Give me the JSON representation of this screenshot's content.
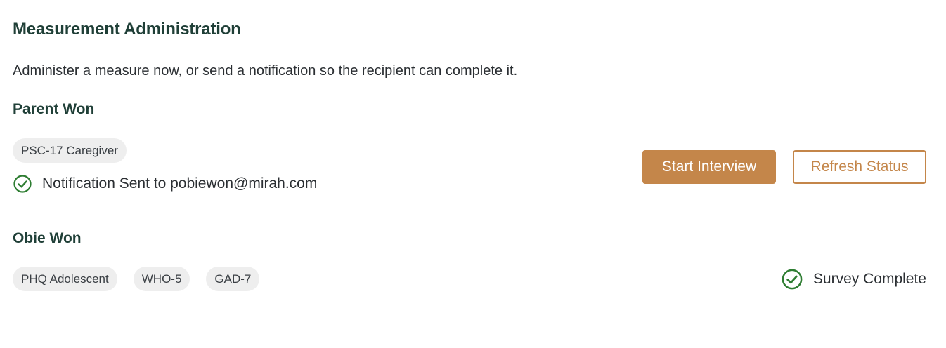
{
  "page": {
    "title": "Measurement Administration",
    "subtitle": "Administer a measure now, or send a notification so the recipient can complete it."
  },
  "recipients": [
    {
      "name": "Parent Won",
      "measures": [
        "PSC-17 Caregiver"
      ],
      "status_text": "Notification Sent to pobiewon@mirah.com",
      "start_button": "Start Interview",
      "refresh_button": "Refresh Status"
    },
    {
      "name": "Obie Won",
      "measures": [
        "PHQ Adolescent",
        "WHO-5",
        "GAD-7"
      ],
      "status_text": "Survey Complete"
    }
  ],
  "colors": {
    "heading": "#1f3f37",
    "accent": "#c4864a",
    "success": "#2e7d32",
    "chip_bg": "#eeeeee"
  },
  "icons": {
    "status_icon": "check-circle-icon"
  }
}
